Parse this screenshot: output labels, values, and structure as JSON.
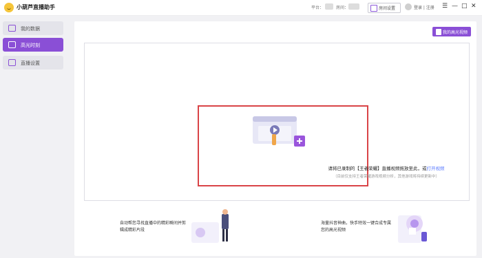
{
  "app": {
    "title": "小葫芦直播助手"
  },
  "header": {
    "platform_label": "平台：",
    "room_label": "房间：",
    "room_settings_label": "房间设置",
    "login_text": "登录 | 注册",
    "menu_icon": "menu-icon",
    "min_icon": "minimize-icon",
    "max_icon": "maximize-icon",
    "close_icon": "close-icon"
  },
  "sidebar": {
    "items": [
      {
        "label": "我的数据",
        "icon": "data-icon"
      },
      {
        "label": "高光时刻",
        "icon": "highlight-icon",
        "active": true
      },
      {
        "label": "直播设置",
        "icon": "live-settings-icon"
      }
    ]
  },
  "main": {
    "my_clips_label": "我的高光视频",
    "dropzone": {
      "prompt_prefix": "请将已录制的【王者荣耀】直播视频拖放至此，或",
      "prompt_link": "打开视频",
      "hint": "（目前仅支持王者荣耀游戏视频分析，其他游戏将持续更新中）"
    },
    "features": [
      {
        "text": "自动帮您寻找直播中的精彩瞬间并剪辑成精彩片段"
      },
      {
        "text": "海量抖音神曲，快手特效一键合成专属您的高光视频"
      }
    ]
  },
  "colors": {
    "accent": "#8a4fd6",
    "link": "#5a7bff",
    "focus_border": "#d94346"
  }
}
